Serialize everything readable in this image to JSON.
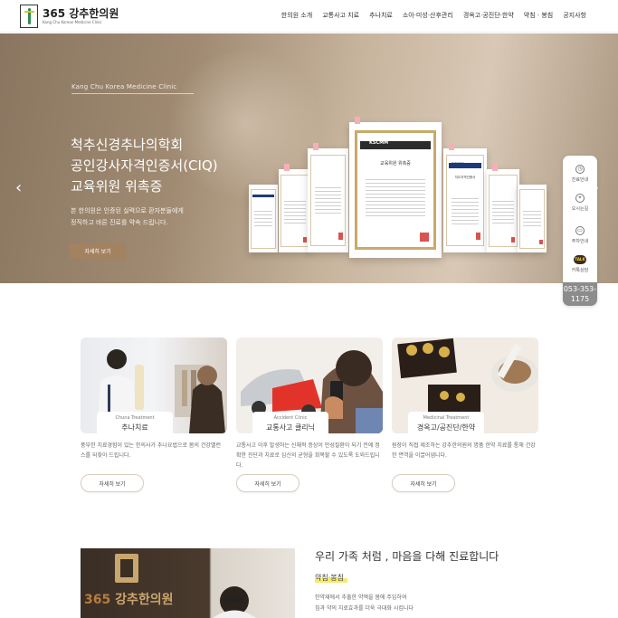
{
  "header": {
    "logo_title": "365 강추한의원",
    "logo_sub": "Kang Chu Korean Medicine Clinic",
    "nav": [
      "한의원 소개",
      "교통사고 치료",
      "추나치료",
      "소아·미성·산후관리",
      "경옥고·공진단·한약",
      "약침 · 봉침",
      "공지사항"
    ]
  },
  "hero": {
    "eyebrow": "Kang Chu Korea Medicine Clinic",
    "title_lines": [
      "척추신경추나의학회",
      "공인강사자격인증서(CIQ)",
      "교육위원 위촉증"
    ],
    "desc_lines": [
      "본 한의원은 인증된 실력으로 환자분들에게",
      "정직하고 바른 진료를 약속 드립니다."
    ],
    "button": "자세히 보기",
    "arrow_left": "‹",
    "arrow_right": "›",
    "certificates": {
      "main_org": "KSCMM",
      "main_title": "교육위원 위촉증",
      "side_org": "SCMM",
      "side_title": "지도자격인증서"
    }
  },
  "quick_menu": {
    "items": [
      {
        "label": "진료안내",
        "icon": "clock-icon"
      },
      {
        "label": "오시는길",
        "icon": "map-pin-icon"
      },
      {
        "label": "주차안내",
        "icon": "car-icon"
      },
      {
        "label": "카톡상담",
        "icon": "kakaotalk-icon",
        "badge": "TALK"
      }
    ],
    "phone_lines": [
      "053-353-",
      "1175"
    ]
  },
  "cards": [
    {
      "en": "Chuna Treatment",
      "kr": "추나치료",
      "desc": "풍부한 치료경험이 있는 한의사가 추나요법으로 몸의 건강밸런스를 되찾아 드립니다.",
      "button": "자세히 보기"
    },
    {
      "en": "Accident Clinic",
      "kr": "교통사고 클리닉",
      "desc": "교통사고 이후 발생하는 신체적 증상이 만성질환이 되기 전에 정확한 진단과 치료로 심신의 균형을 회복할 수 있도록 도와드립니다.",
      "button": "자세히 보기"
    },
    {
      "en": "Medicinal Treatment",
      "kr": "경옥고/공진단/한약",
      "desc": "원장이 직접 제조하는 강추한의원의 명품 한약 치료를 통해 건강한 면역을 이끌어냅니다.",
      "button": "자세히 보기"
    }
  ],
  "bottom": {
    "sign_num": "365",
    "sign_text": "강추한의원",
    "title": "우리 가족 처럼 , 마음을 다해 진료합니다",
    "sub": "약침·봉침",
    "desc_lines": [
      "한약재에서 추출한 약액을 몸에 주입하여",
      "침과 약의 치료효과를 더욱 극대화 시킵니다"
    ]
  }
}
